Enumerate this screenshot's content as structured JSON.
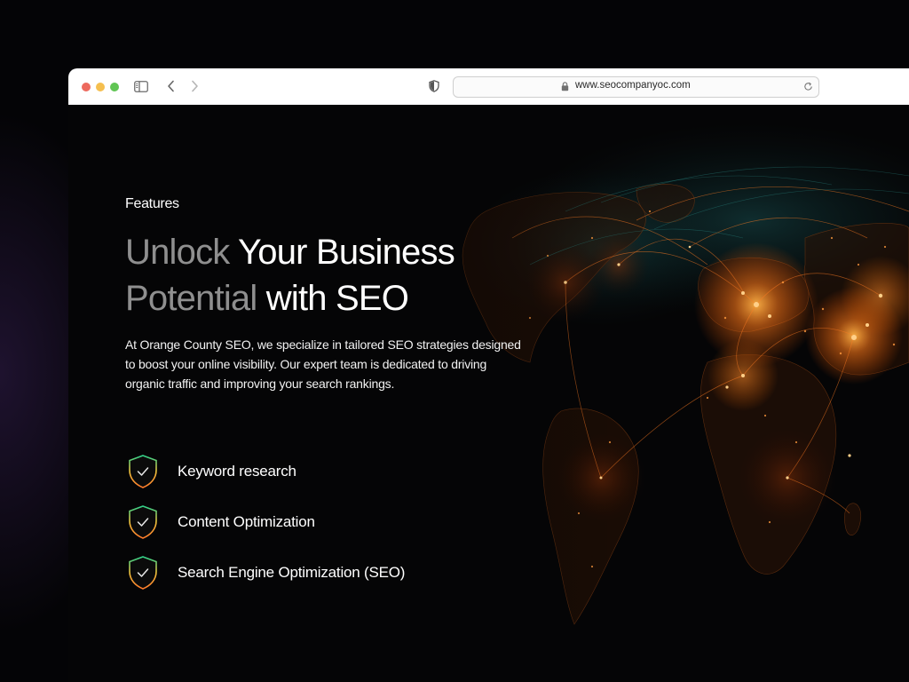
{
  "browser": {
    "url": "www.seocompanyoc.com"
  },
  "hero": {
    "eyebrow": "Features",
    "headline": {
      "line1_dim": "Unlock",
      "line1_bright": " Your Business",
      "line2_dim": "Potential",
      "line2_bright": " with SEO"
    },
    "description": "At Orange County SEO, we specialize in tailored SEO strategies designed to boost your online visibility. Our expert team is dedicated to driving organic traffic and improving your search rankings."
  },
  "features": [
    {
      "label": "Keyword research",
      "icon": "shield-check-icon"
    },
    {
      "label": "Content Optimization",
      "icon": "shield-check-icon"
    },
    {
      "label": "Search Engine Optimization (SEO)",
      "icon": "shield-check-icon"
    }
  ],
  "colors": {
    "accent_orange": "#ff8a1e",
    "network_teal": "#1d6b6b",
    "shield_gradient": [
      "#2fd28a",
      "#f0c33c",
      "#ff7a2a"
    ]
  }
}
